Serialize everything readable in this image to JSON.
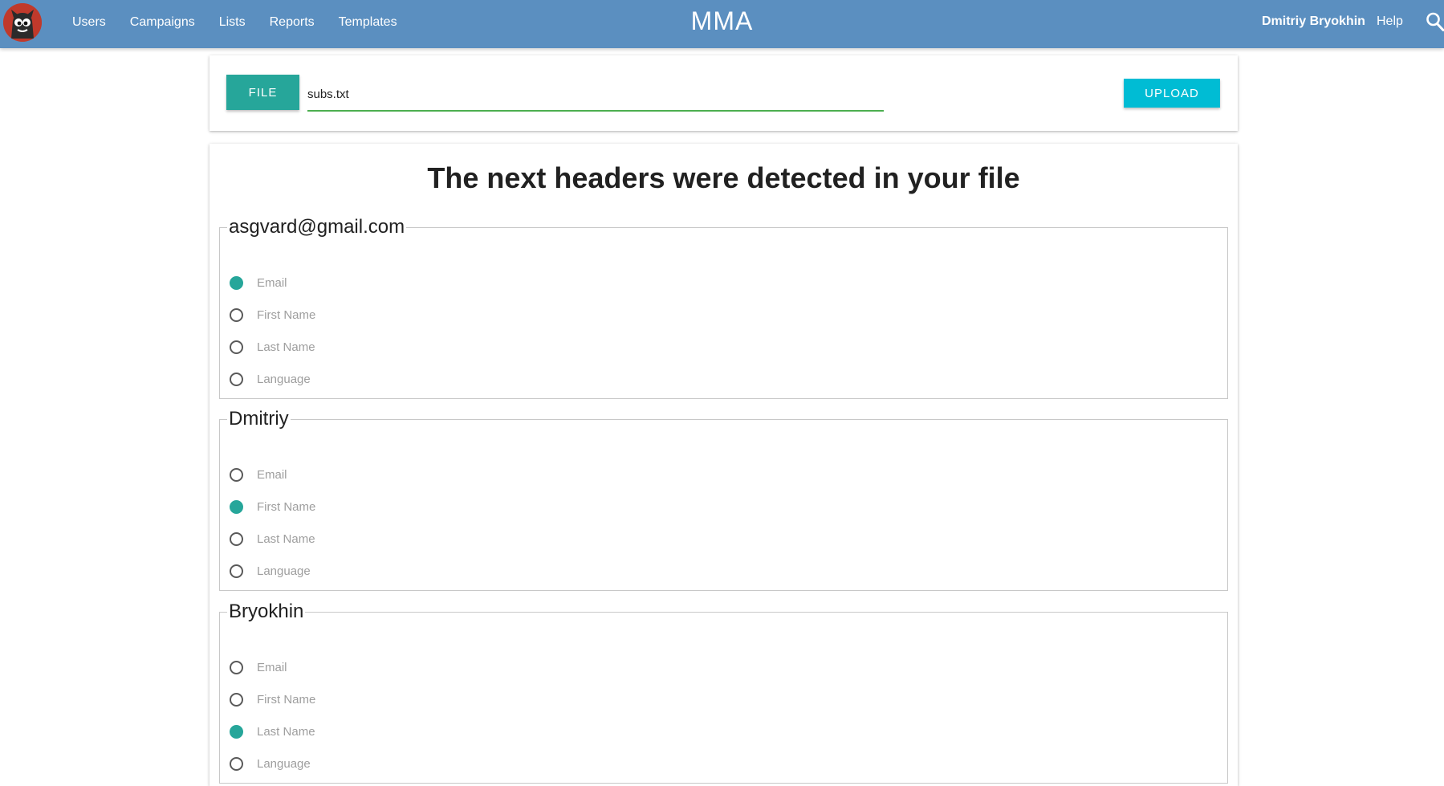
{
  "nav": {
    "links": [
      "Users",
      "Campaigns",
      "Lists",
      "Reports",
      "Templates"
    ],
    "brand": "MMA",
    "user": "Dmitriy Bryokhin",
    "help": "Help",
    "bar_color": "#5b8fc0",
    "search_icon": "search-icon",
    "logo_icon": "monster-logo"
  },
  "upload": {
    "file_button": "FILE",
    "file_name": "subs.txt",
    "upload_button": "UPLOAD",
    "accent": "#26a69a",
    "upload_color": "#00bcd4"
  },
  "mapping": {
    "title": "The next headers were detected in your file",
    "groups": [
      {
        "legend": "asgvard@gmail.com",
        "options": [
          {
            "label": "Email",
            "checked": true
          },
          {
            "label": "First Name",
            "checked": false
          },
          {
            "label": "Last Name",
            "checked": false
          },
          {
            "label": "Language",
            "checked": false
          }
        ]
      },
      {
        "legend": "Dmitriy",
        "options": [
          {
            "label": "Email",
            "checked": false
          },
          {
            "label": "First Name",
            "checked": true
          },
          {
            "label": "Last Name",
            "checked": false
          },
          {
            "label": "Language",
            "checked": false
          }
        ]
      },
      {
        "legend": "Bryokhin",
        "options": [
          {
            "label": "Email",
            "checked": false
          },
          {
            "label": "First Name",
            "checked": false
          },
          {
            "label": "Last Name",
            "checked": true
          },
          {
            "label": "Language",
            "checked": false
          }
        ]
      }
    ]
  }
}
